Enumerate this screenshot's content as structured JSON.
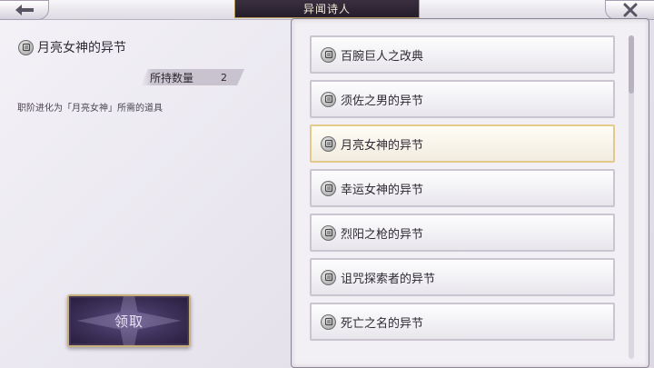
{
  "header": {
    "title": "异闻诗人",
    "back_icon": "left-arrow-icon",
    "close_icon": "close-icon"
  },
  "detail": {
    "item_name": "月亮女神的异节",
    "quantity_label": "所持数量",
    "quantity_value": "2",
    "description": "职阶进化为「月亮女神」所需的道具",
    "claim_label": "领取"
  },
  "list": {
    "items": [
      {
        "label": "百腕巨人之改典",
        "selected": false
      },
      {
        "label": "须佐之男的异节",
        "selected": false
      },
      {
        "label": "月亮女神的异节",
        "selected": true
      },
      {
        "label": "幸运女神的异节",
        "selected": false
      },
      {
        "label": "烈阳之枪的异节",
        "selected": false
      },
      {
        "label": "诅咒探索者的异节",
        "selected": false
      },
      {
        "label": "死亡之名的异节",
        "selected": false
      }
    ]
  },
  "colors": {
    "accent_gold": "#e3c98c",
    "title_bg": "#2b2230",
    "button_purple": "#3c3058"
  }
}
